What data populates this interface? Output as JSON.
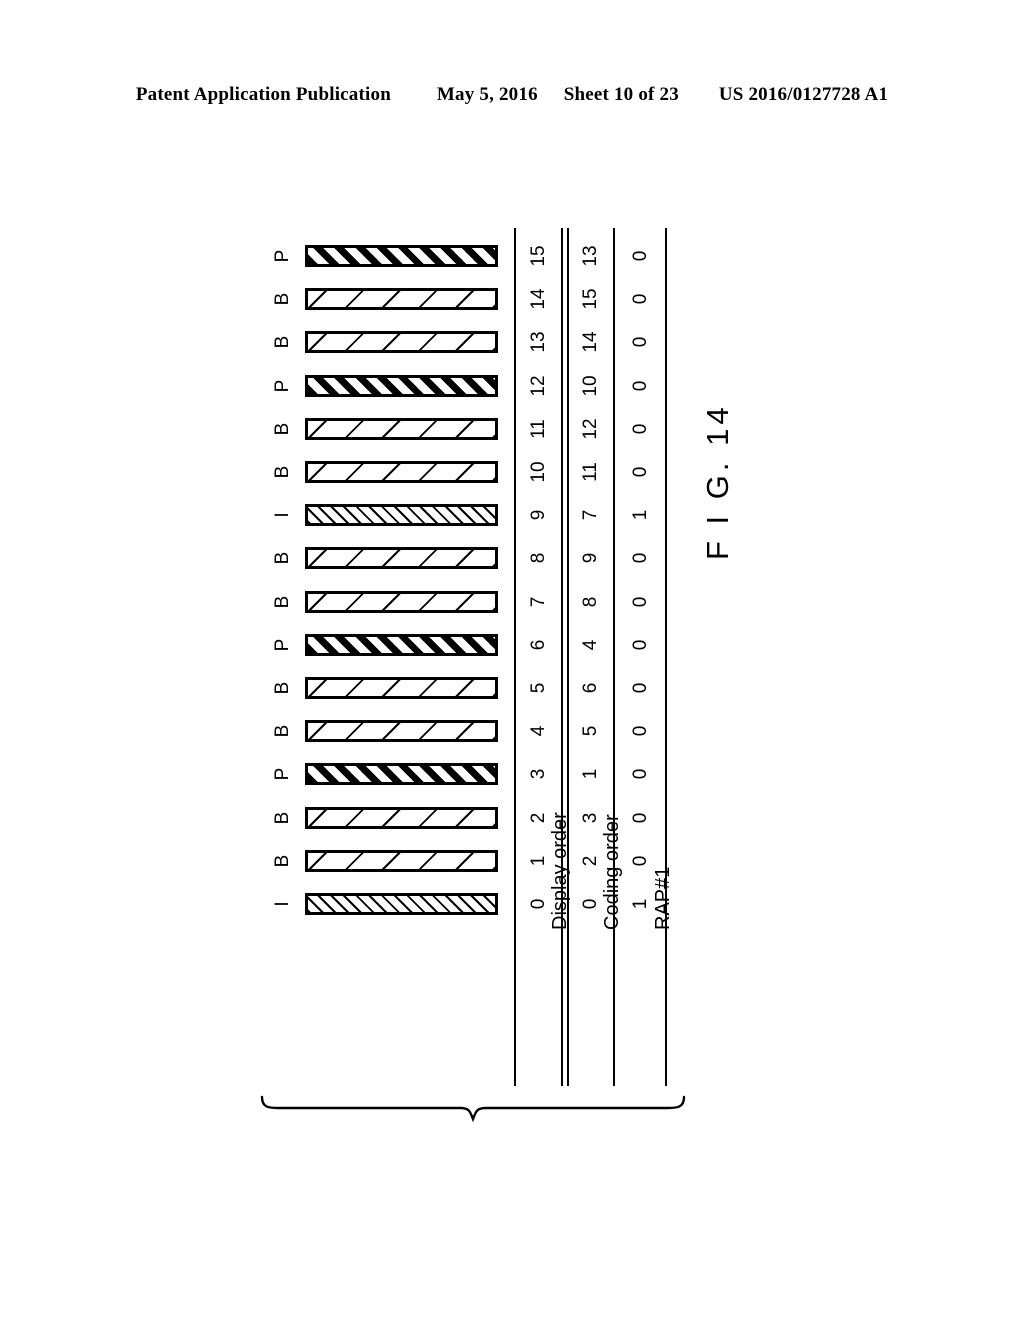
{
  "header": {
    "publication": "Patent Application Publication",
    "date": "May 5, 2016",
    "sheet": "Sheet 10 of 23",
    "patent_number": "US 2016/0127728 A1"
  },
  "figure": {
    "caption": "F I G. 14",
    "row_labels": {
      "display_order": "Display order",
      "coding_order": "Coding order",
      "rap": "RAP#1"
    },
    "frames": [
      {
        "type": "P",
        "display_order": "15",
        "coding_order": "13",
        "rap": "0"
      },
      {
        "type": "B",
        "display_order": "14",
        "coding_order": "15",
        "rap": "0"
      },
      {
        "type": "B",
        "display_order": "13",
        "coding_order": "14",
        "rap": "0"
      },
      {
        "type": "P",
        "display_order": "12",
        "coding_order": "10",
        "rap": "0"
      },
      {
        "type": "B",
        "display_order": "11",
        "coding_order": "12",
        "rap": "0"
      },
      {
        "type": "B",
        "display_order": "10",
        "coding_order": "11",
        "rap": "0"
      },
      {
        "type": "I",
        "display_order": "9",
        "coding_order": "7",
        "rap": "1"
      },
      {
        "type": "B",
        "display_order": "8",
        "coding_order": "9",
        "rap": "0"
      },
      {
        "type": "B",
        "display_order": "7",
        "coding_order": "8",
        "rap": "0"
      },
      {
        "type": "P",
        "display_order": "6",
        "coding_order": "4",
        "rap": "0"
      },
      {
        "type": "B",
        "display_order": "5",
        "coding_order": "6",
        "rap": "0"
      },
      {
        "type": "B",
        "display_order": "4",
        "coding_order": "5",
        "rap": "0"
      },
      {
        "type": "P",
        "display_order": "3",
        "coding_order": "1",
        "rap": "0"
      },
      {
        "type": "B",
        "display_order": "2",
        "coding_order": "3",
        "rap": "0"
      },
      {
        "type": "B",
        "display_order": "1",
        "coding_order": "2",
        "rap": "0"
      },
      {
        "type": "I",
        "display_order": "0",
        "coding_order": "0",
        "rap": "1"
      }
    ]
  }
}
